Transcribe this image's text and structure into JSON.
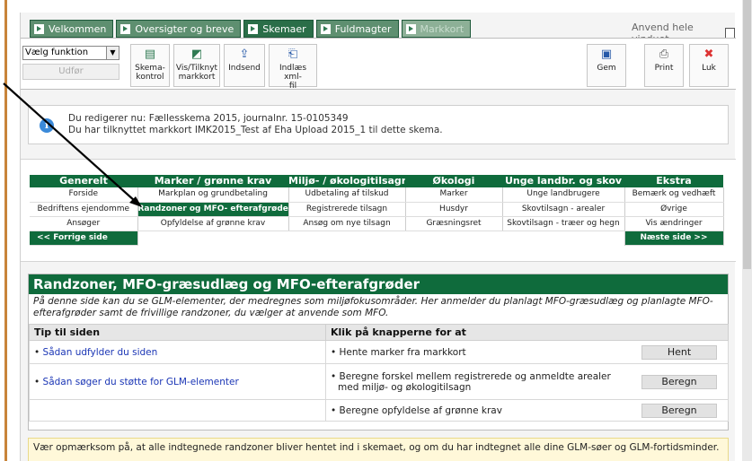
{
  "tabs": [
    {
      "label": "Velkommen",
      "state": "inactive"
    },
    {
      "label": "Oversigter og breve",
      "state": "inactive"
    },
    {
      "label": "Skemaer",
      "state": "active"
    },
    {
      "label": "Fuldmagter",
      "state": "inactive"
    },
    {
      "label": "Markkort",
      "state": "disabled"
    }
  ],
  "anvend_label": "Anvend hele vinduet",
  "toolbar": {
    "select_value": "Vælg funktion",
    "udfor_label": "Udfør",
    "buttons": {
      "skemakontrol": "Skema-\nkontrol",
      "vistilknyt": "Vis/Tilknyt\nmarkkort",
      "indsend": "Indsend",
      "indlaes": "Indlæs xml-\nfil",
      "gem": "Gem",
      "print": "Print",
      "luk": "Luk"
    }
  },
  "info": {
    "line1": "Du redigerer nu: Fællesskema 2015, journalnr. 15-0105349",
    "line2": "Du har tilknyttet markkort IMK2015_Test af Eha Upload 2015_1 til dette skema."
  },
  "nav": {
    "headers": [
      "Generelt",
      "Marker / grønne krav",
      "Miljø- / økologitilsagn",
      "Økologi",
      "Unge landbr. og skov",
      "Ekstra"
    ],
    "rows": [
      [
        "Forside",
        "Markplan og grundbetaling",
        "Udbetaling af tilskud",
        "Marker",
        "Unge landbrugere",
        "Bemærk og vedhæft"
      ],
      [
        "Bedriftens ejendomme",
        "Randzoner og MFO- efterafgrøder",
        "Registrerede tilsagn",
        "Husdyr",
        "Skovtilsagn - arealer",
        "Øvrige"
      ],
      [
        "Ansøger",
        "Opfyldelse af grønne krav",
        "Ansøg om nye tilsagn",
        "Græsningsret",
        "Skovtilsagn - træer og hegn",
        "Vis ændringer"
      ]
    ],
    "prev_label": "<< Forrige side",
    "next_label": "Næste side >>"
  },
  "content": {
    "title": "Randzoner, MFO-græsudlæg og MFO-efterafgrøder",
    "description": "På denne side kan du se GLM-elementer, der medregnes som miljøfokusområder. Her anmelder du planlagt MFO-græsudlæg og planlagte MFO-efterafgrøder samt de frivillige randzoner, du vælger at anvende som MFO.",
    "col_tip": "Tip til siden",
    "col_knap": "Klik på knapperne for at",
    "rows": [
      {
        "tip": "Sådan udfylder du siden",
        "action": "Hente marker fra markkort",
        "button": "Hent"
      },
      {
        "tip": "Sådan søger du støtte for GLM-elementer",
        "action": "Beregne forskel mellem registrerede og anmeldte arealer med miljø- og økologitilsagn",
        "button": "Beregn"
      },
      {
        "tip": "",
        "action": "Beregne opfyldelse af grønne krav",
        "button": "Beregn"
      }
    ]
  },
  "warning": "Vær opmærksom på, at alle indtegnede randzoner bliver hentet ind i skemaet, og om du har indtegnet alle dine GLM-søer og GLM-fortidsminder."
}
